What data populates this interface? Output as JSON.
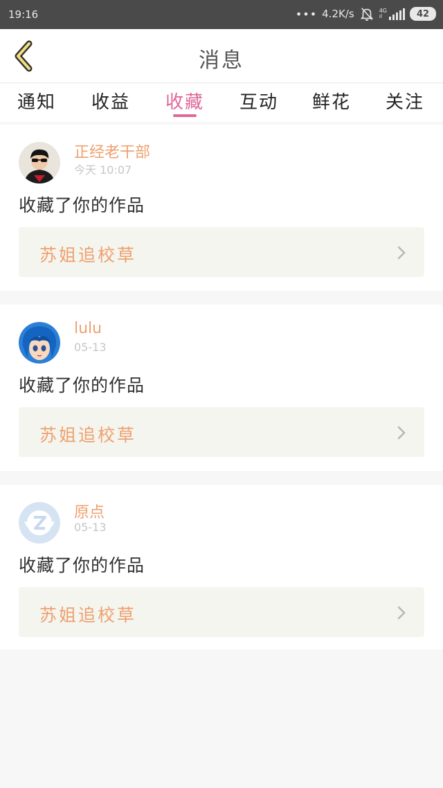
{
  "status_bar": {
    "time": "19:16",
    "dots": "•••",
    "net_speed": "4.2K/s",
    "network_type": "4G",
    "network_sub": "ıl",
    "battery": "42"
  },
  "header": {
    "title": "消息"
  },
  "tabs": [
    {
      "label": "通知",
      "active": false
    },
    {
      "label": "收益",
      "active": false
    },
    {
      "label": "收藏",
      "active": true
    },
    {
      "label": "互动",
      "active": false
    },
    {
      "label": "鲜花",
      "active": false
    },
    {
      "label": "关注",
      "active": false
    }
  ],
  "messages": [
    {
      "user": "正经老干部",
      "time": "今天 10:07",
      "action": "收藏了你的作品",
      "work_title": "苏姐追校草"
    },
    {
      "user": "lulu",
      "time": "05-13",
      "action": "收藏了你的作品",
      "work_title": "苏姐追校草"
    },
    {
      "user": "原点",
      "time": "05-13",
      "action": "收藏了你的作品",
      "work_title": "苏姐追校草"
    }
  ],
  "colors": {
    "accent": "#e0679a",
    "username": "#eea06f",
    "status_bar": "#4a4a4a",
    "work_bg": "#f5f5ef"
  }
}
